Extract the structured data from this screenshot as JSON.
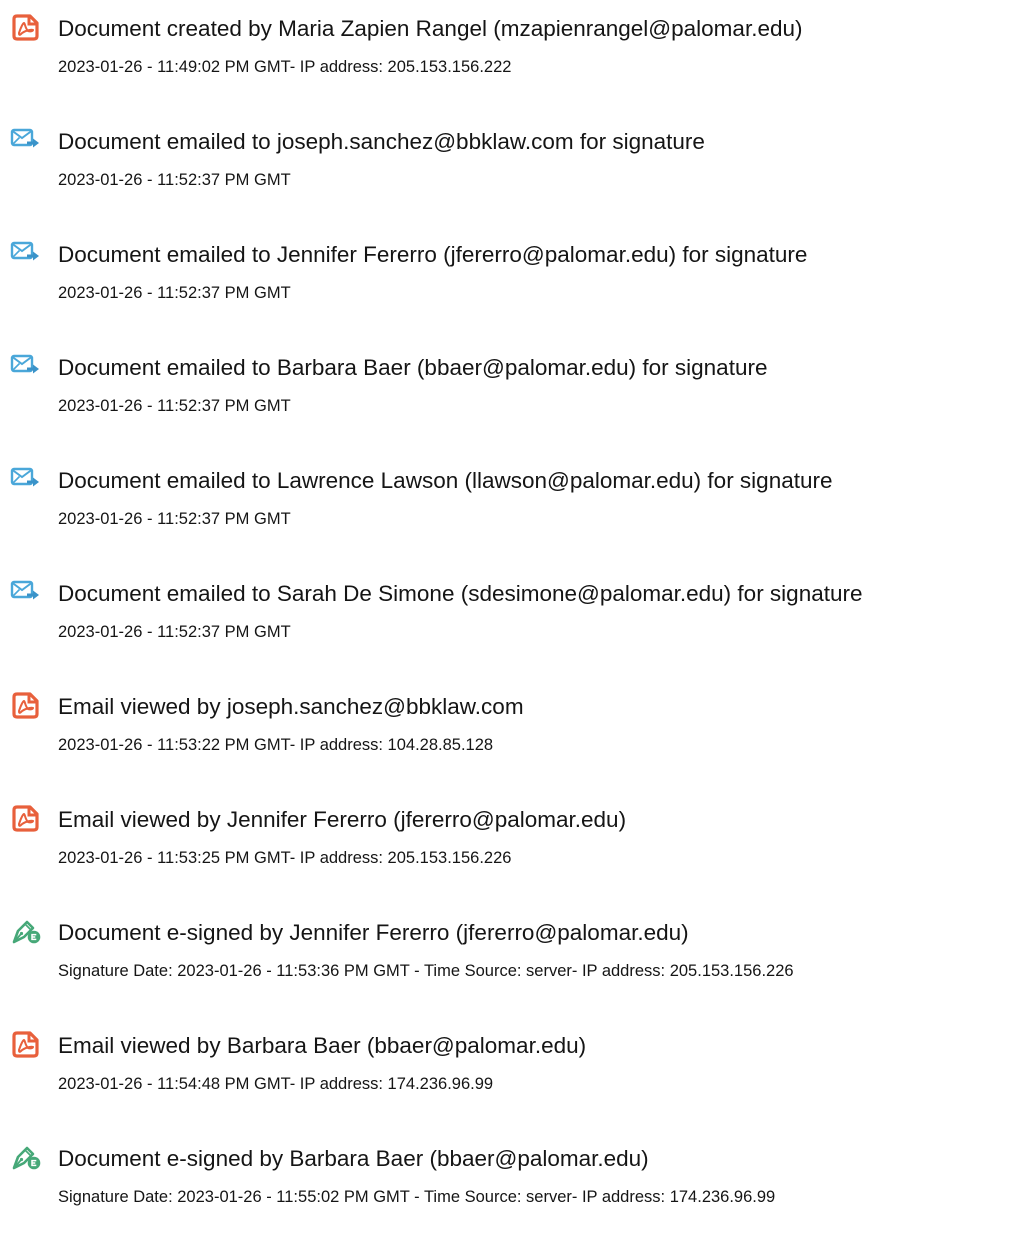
{
  "colors": {
    "acrobat_red": "#e8603c",
    "email_blue": "#4aa7d9",
    "esign_green": "#46a878"
  },
  "entries": [
    {
      "icon": "acrobat-document-icon",
      "title": "Document created by Maria Zapien Rangel (mzapienrangel@palomar.edu)",
      "detail": "2023-01-26 - 11:49:02 PM GMT- IP address: 205.153.156.222"
    },
    {
      "icon": "email-sent-icon",
      "title": "Document emailed to joseph.sanchez@bbklaw.com for signature",
      "detail": "2023-01-26 - 11:52:37 PM GMT"
    },
    {
      "icon": "email-sent-icon",
      "title": "Document emailed to Jennifer Fererro (jfererro@palomar.edu) for signature",
      "detail": "2023-01-26 - 11:52:37 PM GMT"
    },
    {
      "icon": "email-sent-icon",
      "title": "Document emailed to Barbara Baer (bbaer@palomar.edu) for signature",
      "detail": "2023-01-26 - 11:52:37 PM GMT"
    },
    {
      "icon": "email-sent-icon",
      "title": "Document emailed to Lawrence Lawson (llawson@palomar.edu) for signature",
      "detail": "2023-01-26 - 11:52:37 PM GMT"
    },
    {
      "icon": "email-sent-icon",
      "title": "Document emailed to Sarah De Simone (sdesimone@palomar.edu) for signature",
      "detail": "2023-01-26 - 11:52:37 PM GMT"
    },
    {
      "icon": "acrobat-document-icon",
      "title": "Email viewed by joseph.sanchez@bbklaw.com",
      "detail": "2023-01-26 - 11:53:22 PM GMT- IP address: 104.28.85.128"
    },
    {
      "icon": "acrobat-document-icon",
      "title": "Email viewed by Jennifer Fererro (jfererro@palomar.edu)",
      "detail": "2023-01-26 - 11:53:25 PM GMT- IP address: 205.153.156.226"
    },
    {
      "icon": "esign-pen-icon",
      "title": "Document e-signed by Jennifer Fererro (jfererro@palomar.edu)",
      "detail": "Signature Date: 2023-01-26 - 11:53:36 PM GMT - Time Source: server- IP address: 205.153.156.226"
    },
    {
      "icon": "acrobat-document-icon",
      "title": "Email viewed by Barbara Baer (bbaer@palomar.edu)",
      "detail": "2023-01-26 - 11:54:48 PM GMT- IP address: 174.236.96.99"
    },
    {
      "icon": "esign-pen-icon",
      "title": "Document e-signed by Barbara Baer (bbaer@palomar.edu)",
      "detail": "Signature Date: 2023-01-26 - 11:55:02 PM GMT - Time Source: server- IP address: 174.236.96.99"
    }
  ]
}
